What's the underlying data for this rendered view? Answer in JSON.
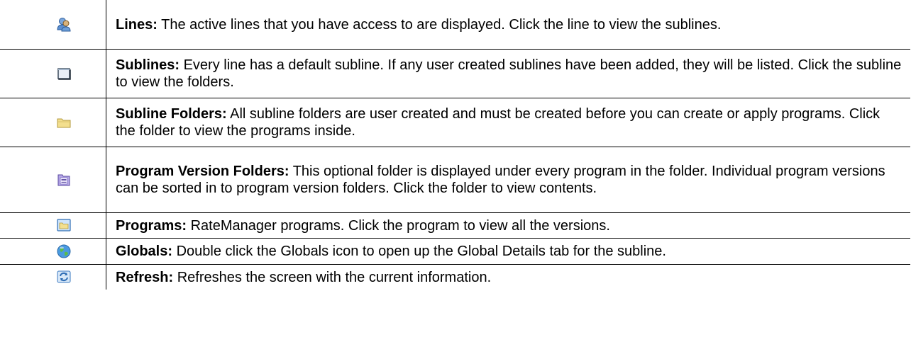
{
  "rows": [
    {
      "icon": "users-icon",
      "term": "Lines:",
      "description": "The active lines that you have access to are displayed. Click the line to view the sublines."
    },
    {
      "icon": "window-icon",
      "term": "Sublines:",
      "description": "Every line has a default subline. If any user created sublines have been added, they will be listed. Click the subline to view the folders."
    },
    {
      "icon": "folder-icon",
      "term": "Subline Folders:",
      "description": "All subline folders are user created and must be created before you can create or apply programs. Click the folder to view the programs inside."
    },
    {
      "icon": "document-folder-icon",
      "term": "Program Version Folders:",
      "description": "This optional folder is displayed under every program in the folder. Individual program versions can be sorted in to program version folders. Click the folder to view contents."
    },
    {
      "icon": "program-folder-icon",
      "term": "Programs:",
      "description": "RateManager programs. Click the program to view all the versions."
    },
    {
      "icon": "globe-icon",
      "term": "Globals:",
      "description": "Double click the Globals icon to open up the Global Details tab for the subline."
    },
    {
      "icon": "refresh-icon",
      "term": "Refresh:",
      "description": "Refreshes the screen with the current information."
    }
  ]
}
